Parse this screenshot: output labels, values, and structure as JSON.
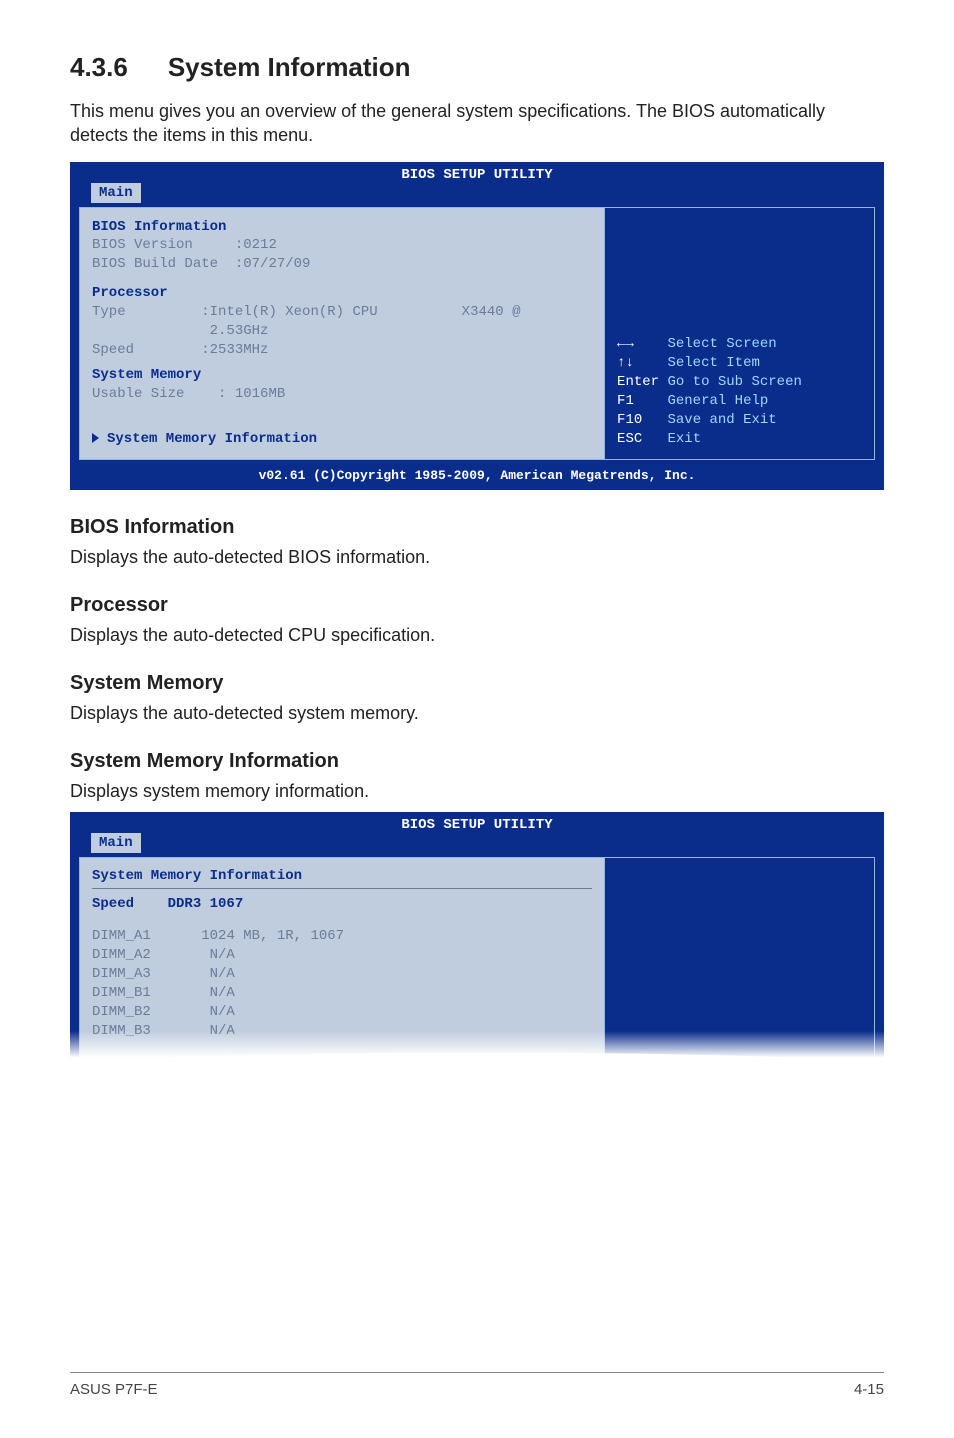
{
  "section": {
    "number": "4.3.6",
    "title": "System Information",
    "intro": "This menu gives you an overview of the general system specifications. The BIOS automatically detects the items in this menu."
  },
  "bios1": {
    "header": "BIOS SETUP UTILITY",
    "tab": "Main",
    "left": {
      "heading_bios_info": "BIOS Information",
      "bios_version_label": "BIOS Version",
      "bios_version_value": ":0212",
      "bios_build_label": "BIOS Build Date",
      "bios_build_value": ":07/27/09",
      "processor_heading": "Processor",
      "type_label": "Type",
      "type_value": ":Intel(R) Xeon(R) CPU          X3440 @",
      "type_value2": "2.53GHz",
      "speed_label": "Speed",
      "speed_value": ":2533MHz",
      "sysmem_heading": "System Memory",
      "usable_label": "Usable Size",
      "usable_value": ": 1016MB",
      "submenu": "System Memory Information"
    },
    "right": {
      "arrows_lr": "←→",
      "select_screen": "Select Screen",
      "arrows_ud": "↑↓",
      "select_item": "Select Item",
      "enter_key": "Enter",
      "enter_text": "Go to Sub Screen",
      "f1_key": "F1",
      "f1_text": "General Help",
      "f10_key": "F10",
      "f10_text": "Save and Exit",
      "esc_key": "ESC",
      "esc_text": "Exit"
    },
    "footer": "v02.61 (C)Copyright 1985-2009, American Megatrends, Inc."
  },
  "subsections": {
    "bios_info_h": "BIOS Information",
    "bios_info_p": "Displays the auto-detected BIOS information.",
    "processor_h": "Processor",
    "processor_p": "Displays the auto-detected CPU specification.",
    "sysmem_h": "System Memory",
    "sysmem_p": "Displays the auto-detected system memory.",
    "smi_h": "System Memory Information",
    "smi_p": "Displays system memory information."
  },
  "bios2": {
    "header": "BIOS SETUP UTILITY",
    "tab": "Main",
    "title": "System Memory Information",
    "speed_label": "Speed",
    "speed_value": "DDR3 1067",
    "dimms": [
      {
        "slot": "DIMM_A1",
        "val": "1024 MB, 1R, 1067"
      },
      {
        "slot": "DIMM_A2",
        "val": "N/A"
      },
      {
        "slot": "DIMM_A3",
        "val": "N/A"
      },
      {
        "slot": "DIMM_B1",
        "val": "N/A"
      },
      {
        "slot": "DIMM_B2",
        "val": "N/A"
      },
      {
        "slot": "DIMM_B3",
        "val": "N/A"
      }
    ]
  },
  "footer": {
    "left": "ASUS P7F-E",
    "right": "4-15"
  }
}
